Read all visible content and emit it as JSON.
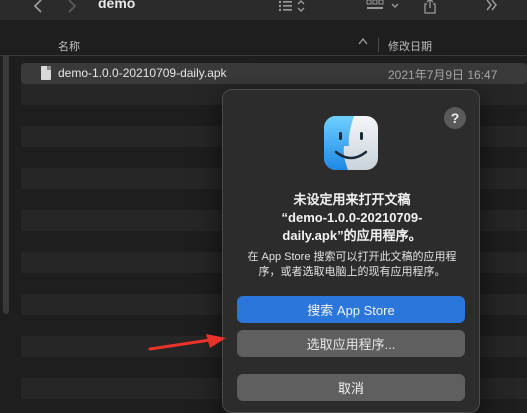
{
  "toolbar": {
    "back_icon": "chevron-left-icon",
    "forward_icon": "chevron-right-icon",
    "title": "demo",
    "list_view_icon": "list-view-icon",
    "grid_view_icon": "grid-view-icon",
    "share_icon": "share-icon",
    "more_icon": "double-chevron-right-icon"
  },
  "columns": {
    "name": "名称",
    "date_modified": "修改日期"
  },
  "files": [
    {
      "name": "demo-1.0.0-20210709-daily.apk",
      "date": "2021年7月9日 16:47"
    }
  ],
  "dialog": {
    "help_label": "?",
    "title_line1": "未设定用来打开文稿",
    "title_line2": "“demo-1.0.0-20210709-",
    "title_line3": "daily.apk”的应用程序。",
    "message_line1": "在 App Store 搜索可以打开此文稿的应用程",
    "message_line2": "序，或者选取电脑上的现有应用程序。",
    "search_button": "搜索 App Store",
    "choose_button": "选取应用程序...",
    "cancel_button": "取消"
  },
  "colors": {
    "accent": "#2a76db",
    "annotation": "#e8322a"
  }
}
